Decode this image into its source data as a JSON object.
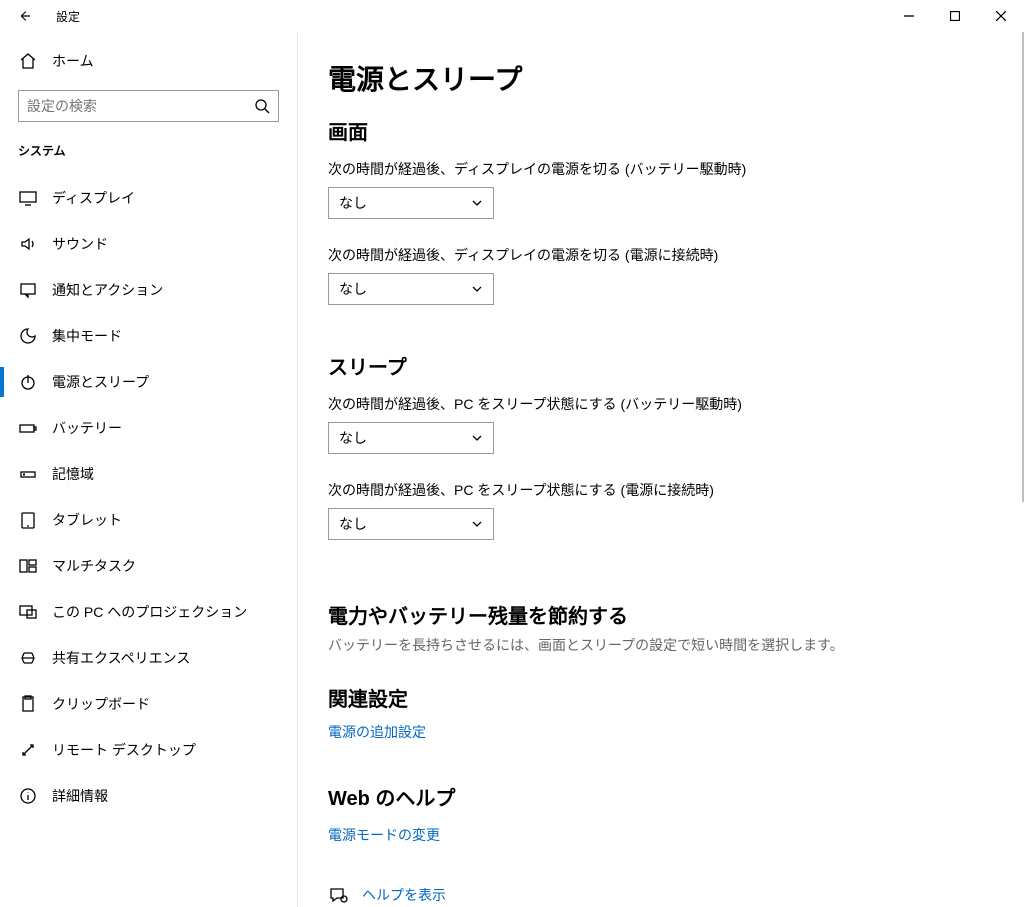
{
  "window": {
    "title": "設定"
  },
  "sidebar": {
    "home_label": "ホーム",
    "search_placeholder": "設定の検索",
    "category": "システム",
    "items": [
      {
        "label": "ディスプレイ"
      },
      {
        "label": "サウンド"
      },
      {
        "label": "通知とアクション"
      },
      {
        "label": "集中モード"
      },
      {
        "label": "電源とスリープ"
      },
      {
        "label": "バッテリー"
      },
      {
        "label": "記憶域"
      },
      {
        "label": "タブレット"
      },
      {
        "label": "マルチタスク"
      },
      {
        "label": "この PC へのプロジェクション"
      },
      {
        "label": "共有エクスペリエンス"
      },
      {
        "label": "クリップボード"
      },
      {
        "label": "リモート デスクトップ"
      },
      {
        "label": "詳細情報"
      }
    ]
  },
  "content": {
    "title": "電源とスリープ",
    "screen": {
      "header": "画面",
      "battery_label": "次の時間が経過後、ディスプレイの電源を切る (バッテリー駆動時)",
      "battery_value": "なし",
      "plugged_label": "次の時間が経過後、ディスプレイの電源を切る (電源に接続時)",
      "plugged_value": "なし"
    },
    "sleep": {
      "header": "スリープ",
      "battery_label": "次の時間が経過後、PC をスリープ状態にする (バッテリー駆動時)",
      "battery_value": "なし",
      "plugged_label": "次の時間が経過後、PC をスリープ状態にする (電源に接続時)",
      "plugged_value": "なし"
    },
    "save_power": {
      "header": "電力やバッテリー残量を節約する",
      "desc": "バッテリーを長持ちさせるには、画面とスリープの設定で短い時間を選択します。"
    },
    "related": {
      "header": "関連設定",
      "link": "電源の追加設定"
    },
    "webhelp": {
      "header": "Web のヘルプ",
      "link": "電源モードの変更"
    },
    "help_row": "ヘルプを表示"
  }
}
